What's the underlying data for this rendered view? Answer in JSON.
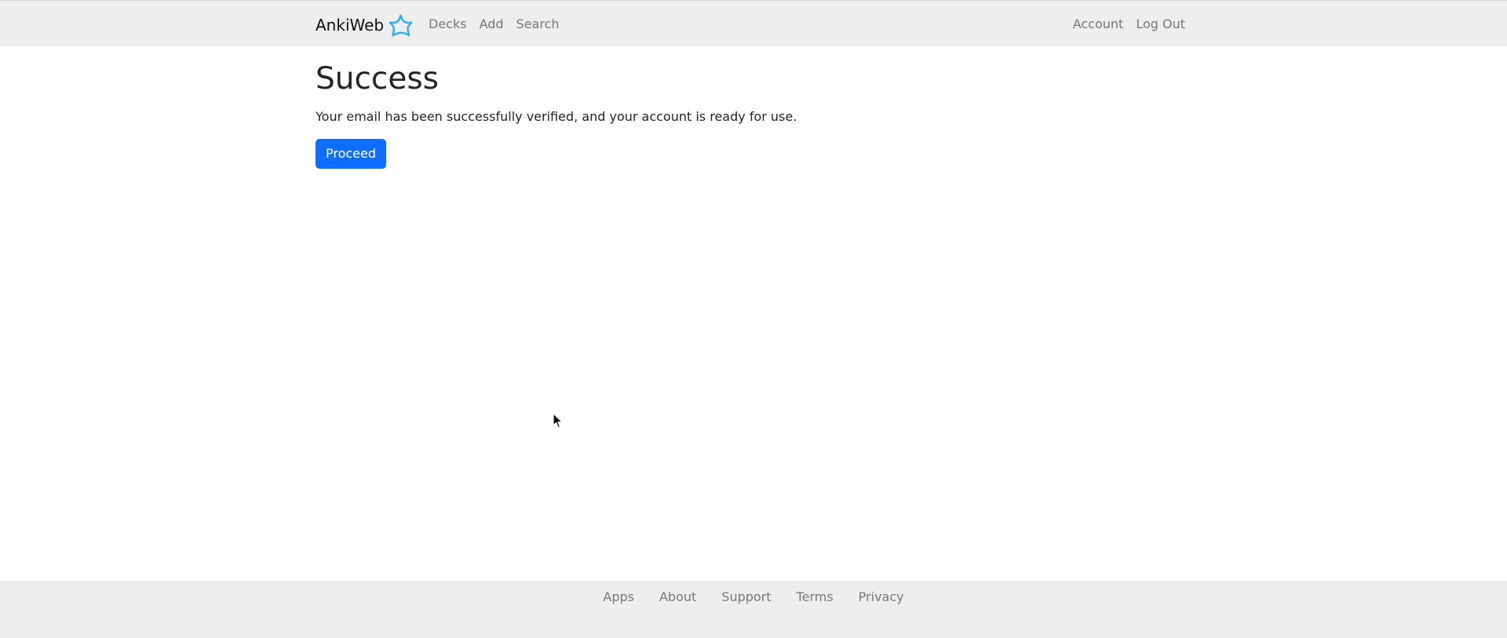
{
  "navbar": {
    "brand": "AnkiWeb",
    "brand_icon": "star-icon",
    "accent_color": "#2ab1e8",
    "left_links": [
      {
        "label": "Decks"
      },
      {
        "label": "Add"
      },
      {
        "label": "Search"
      }
    ],
    "right_links": [
      {
        "label": "Account"
      },
      {
        "label": "Log Out"
      }
    ]
  },
  "main": {
    "title": "Success",
    "message": "Your email has been successfully verified, and your account is ready for use.",
    "proceed_label": "Proceed",
    "button_color": "#0d6efd"
  },
  "footer": {
    "links": [
      {
        "label": "Apps"
      },
      {
        "label": "About"
      },
      {
        "label": "Support"
      },
      {
        "label": "Terms"
      },
      {
        "label": "Privacy"
      }
    ]
  }
}
